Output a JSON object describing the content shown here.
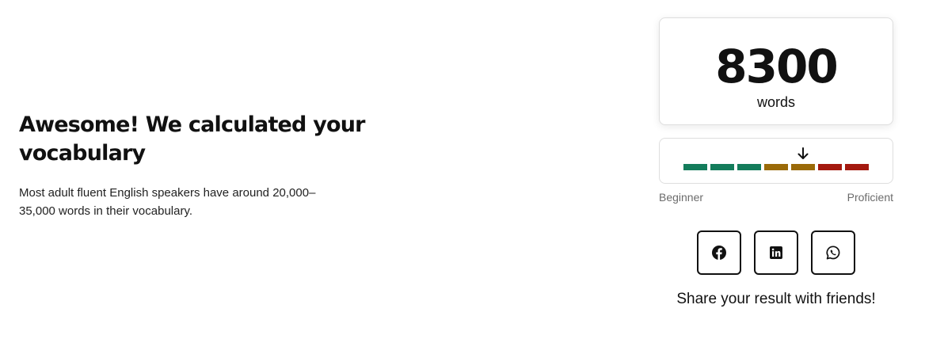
{
  "result": {
    "headline": "Awesome! We calculated your vocabulary",
    "description": "Most adult fluent English speakers have around 20,000–35,000 words in their vocabulary."
  },
  "count": {
    "value": "8300",
    "unit": "words"
  },
  "meter": {
    "segment_colors": [
      "#137c5b",
      "#137c5b",
      "#137c5b",
      "#9a6a08",
      "#9a6a08",
      "#a4190f",
      "#a4190f"
    ],
    "indicator_segment": 4,
    "arrow_icon": "arrow-down-icon",
    "label_low": "Beginner",
    "label_high": "Proficient"
  },
  "share": {
    "buttons": [
      {
        "name": "facebook",
        "icon": "facebook-icon"
      },
      {
        "name": "linkedin",
        "icon": "linkedin-icon"
      },
      {
        "name": "whatsapp",
        "icon": "whatsapp-icon"
      }
    ],
    "text": "Share your result with friends!"
  }
}
